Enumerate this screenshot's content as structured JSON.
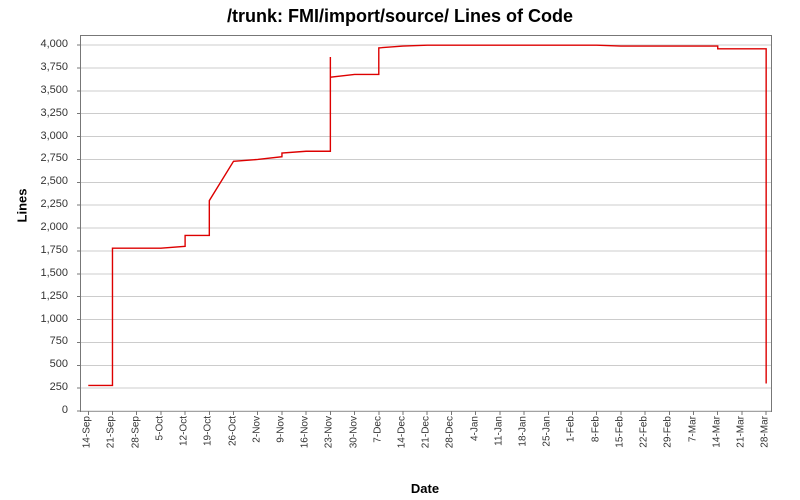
{
  "chart_data": {
    "type": "line",
    "title": "/trunk: FMI/import/source/ Lines of Code",
    "xlabel": "Date",
    "ylabel": "Lines",
    "ylim": [
      0,
      4100
    ],
    "y_ticks": [
      0,
      250,
      500,
      750,
      1000,
      1250,
      1500,
      1750,
      2000,
      2250,
      2500,
      2750,
      3000,
      3250,
      3500,
      3750,
      4000
    ],
    "y_tick_labels": [
      "0",
      "250",
      "500",
      "750",
      "1,000",
      "1,250",
      "1,500",
      "1,750",
      "2,000",
      "2,250",
      "2,500",
      "2,750",
      "3,000",
      "3,250",
      "3,500",
      "3,750",
      "4,000"
    ],
    "x_tick_labels": [
      "14-Sep",
      "21-Sep",
      "28-Sep",
      "5-Oct",
      "12-Oct",
      "19-Oct",
      "26-Oct",
      "2-Nov",
      "9-Nov",
      "16-Nov",
      "23-Nov",
      "30-Nov",
      "7-Dec",
      "14-Dec",
      "21-Dec",
      "28-Dec",
      "4-Jan",
      "11-Jan",
      "18-Jan",
      "25-Jan",
      "1-Feb",
      "8-Feb",
      "15-Feb",
      "22-Feb",
      "29-Feb",
      "7-Mar",
      "14-Mar",
      "21-Mar",
      "28-Mar"
    ],
    "series": [
      {
        "name": "Lines of Code",
        "x": [
          0,
          1,
          1,
          2,
          3,
          4,
          4,
          5,
          5,
          6,
          7,
          8,
          8,
          9,
          9,
          10,
          10,
          10,
          11,
          12,
          12,
          13,
          14,
          15,
          16,
          17,
          18,
          19,
          20,
          21,
          22,
          23,
          24,
          25,
          26,
          26,
          27,
          28,
          28,
          28
        ],
        "y": [
          280,
          280,
          1780,
          1780,
          1780,
          1800,
          1920,
          1920,
          2300,
          2730,
          2750,
          2780,
          2820,
          2840,
          2840,
          2840,
          3870,
          3650,
          3680,
          3680,
          3970,
          3990,
          4000,
          4000,
          4000,
          4000,
          4000,
          4000,
          4000,
          4000,
          3990,
          3990,
          3990,
          3990,
          3990,
          3960,
          3960,
          3960,
          3960,
          300
        ]
      }
    ]
  }
}
